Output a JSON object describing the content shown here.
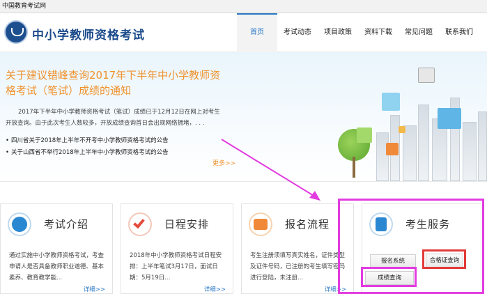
{
  "window": {
    "title": "中国教育考试网"
  },
  "header": {
    "site_title": "中小学教师资格考试",
    "nav": [
      "首页",
      "考试动态",
      "项目政策",
      "资料下载",
      "常见问题",
      "联系我们"
    ]
  },
  "banner": {
    "title": "关于建议错峰查询2017年下半年中小学教师资格考试（笔试）成绩的通知",
    "desc": "2017年下半年中小学教师资格考试（笔试）成绩已于12月12日在网上对考生开放查询。由于此次考生人数较多，开放成绩查询首日会出现网络拥堵，. . .",
    "bullets": [
      "四川省关于2018年上半年不开考中小学教师资格考试的公告",
      "关于山西省不举行2018年上半年中小学教师资格考试的公告"
    ],
    "more": "更多>>"
  },
  "cards": [
    {
      "title": "考试介绍",
      "icon": "document-icon",
      "text": "通过实施中小学教师资格考试，考查申请人是否具备教师职业道德、基本素养、教育教学能...",
      "more": "详细>>"
    },
    {
      "title": "日程安排",
      "icon": "checkmark-icon",
      "text": "2018年中小学教师资格考试日程安排：上半年笔试3月17日，面试日期：5月19日...",
      "more": "详细>>"
    },
    {
      "title": "报名流程",
      "icon": "id-card-icon",
      "text": "考生注册须填写真实姓名，证件类型及证件号码，已注册的考生填写密码进行登陆，未注册...",
      "more": "详细>>"
    },
    {
      "title": "考生服务",
      "icon": "contact-book-icon"
    }
  ],
  "services": {
    "registration": "报名系统",
    "certificate_query": "合格证查询",
    "score_query": "成绩查询"
  },
  "colors": {
    "brand_blue": "#1b4a8a",
    "accent_orange": "#f0922e",
    "highlight_magenta": "#e23be0",
    "highlight_red": "#e23a3a"
  }
}
